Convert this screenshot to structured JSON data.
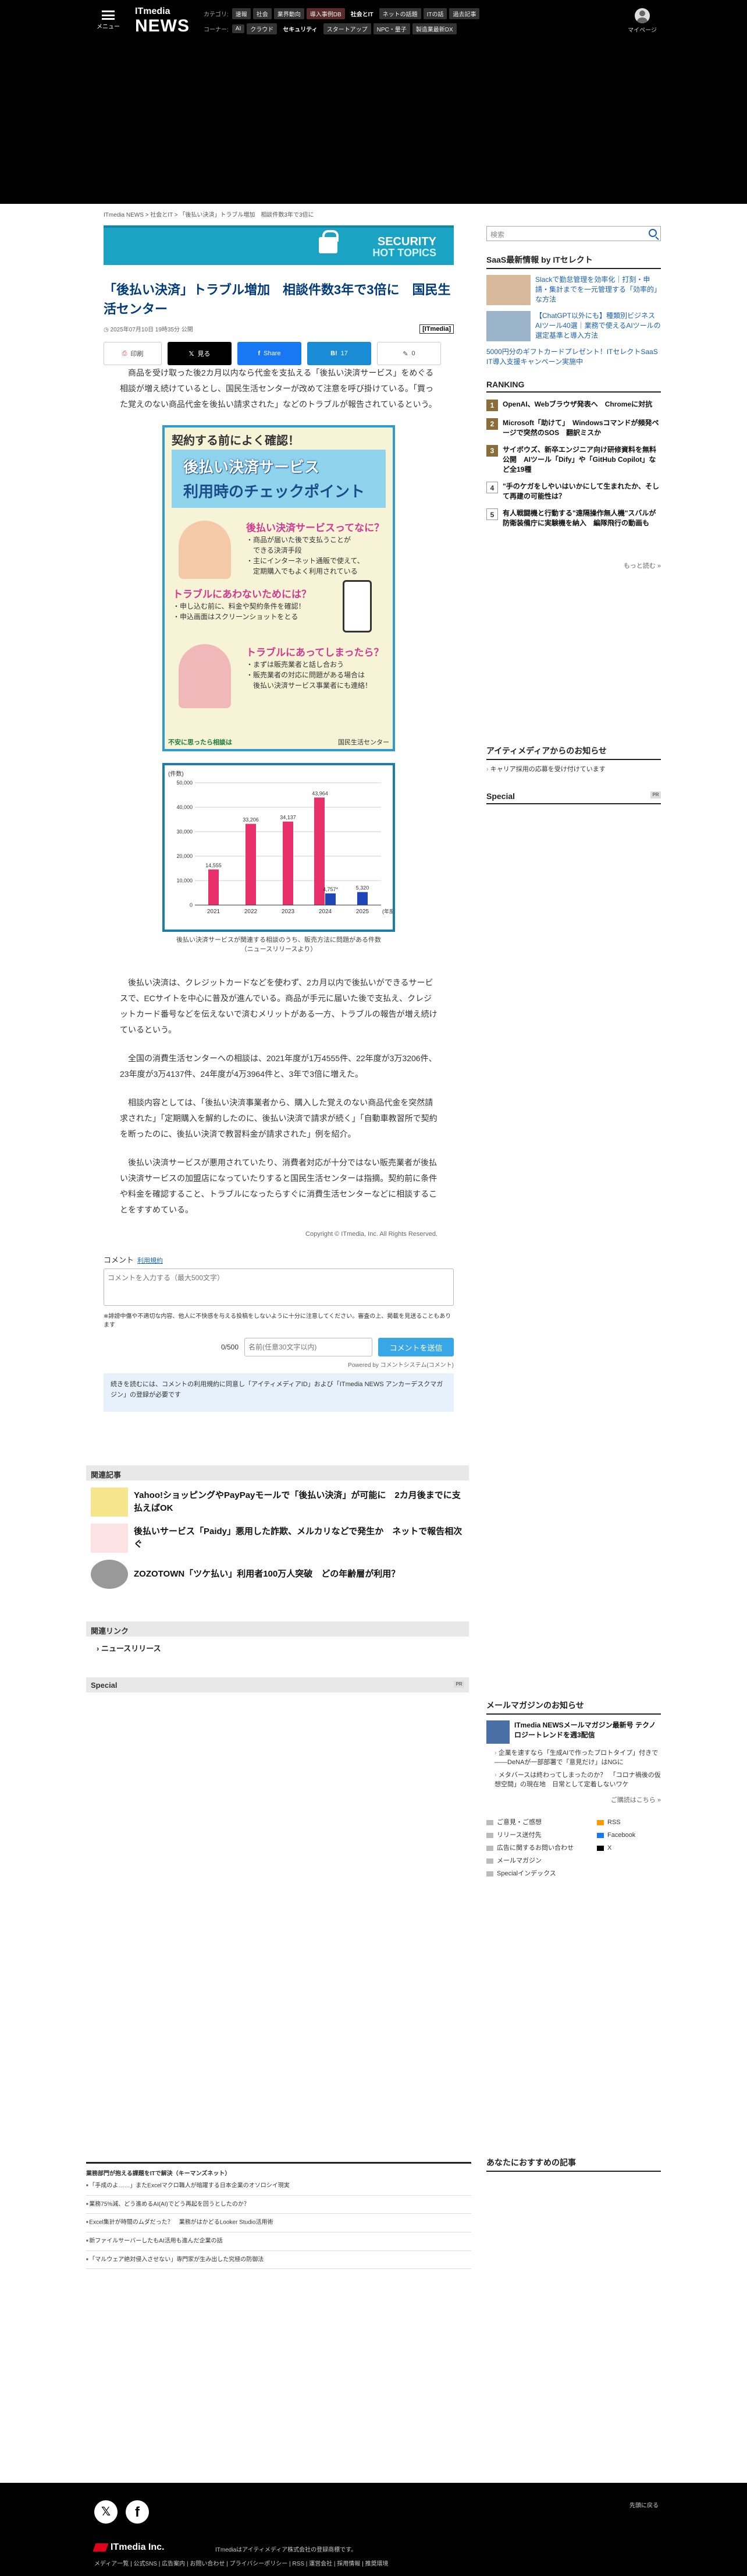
{
  "header": {
    "menu_label": "メニュー",
    "logo_it": "ITmedia",
    "logo_news": "NEWS",
    "categories_label": "カテゴリ:",
    "categories": [
      "速報",
      "社会",
      "業界動向",
      "導入事例DB",
      "社会とIT",
      "ネットの話題",
      "ITの話",
      "過去記事"
    ],
    "corners_label": "コーナー:",
    "corners": [
      "AI",
      "クラウド",
      "セキュリティ",
      "スタートアップ",
      "NPC・量子",
      "製造業最新DX"
    ],
    "mypage": "マイページ"
  },
  "breadcrumb": "ITmedia NEWS > 社会とIT > 「後払い決済」トラブル増加　相談件数3年で3倍に",
  "banner": {
    "line1": "SECURITY",
    "line2": "HOT TOPICS"
  },
  "article": {
    "title": "「後払い決済」トラブル増加　相談件数3年で3倍に　国民生活センター",
    "date": "2025年07月10日 19時35分 公開",
    "source": "[ITmedia]",
    "share": {
      "print": "印刷",
      "x": "見る",
      "facebook": "Share",
      "hatena_count": "17",
      "other_count": "0"
    },
    "paragraphs": [
      "商品を受け取った後2カ月以内なら代金を支払える「後払い決済サービス」をめぐる相談が増え続けているとし、国民生活センターが改めて注意を呼び掛けている。「買った覚えのない商品代金を後払い請求された」などのトラブルが報告されているという。",
      "後払い決済は、クレジットカードなどを使わず、2カ月以内で後払いができるサービスで、ECサイトを中心に普及が進んでいる。商品が手元に届いた後で支払え、クレジットカード番号などを伝えないで済むメリットがある一方、トラブルの報告が増え続けているという。",
      "全国の消費生活センターへの相談は、2021年度が1万4555件、22年度が3万3206件、23年度が3万4137件、24年度が4万3964件と、3年で3倍に増えた。",
      "相談内容としては、「後払い決済事業者から、購入した覚えのない商品代金を突然請求された」「定期購入を解約したのに、後払い決済で請求が続く」「自動車教習所で契約を断ったのに、後払い決済で教習料金が請求された」例を紹介。",
      "後払い決済サービスが悪用されていたり、消費者対応が十分ではない販売業者が後払い決済サービスの加盟店になっていたりすると国民生活センターは指摘。契約前に条件や料金を確認すること、トラブルになったらすぐに消費生活センターなどに相談することをすすめている。"
    ],
    "figure1": {
      "header": "契約する前によく確認！",
      "title1": "後払い決済サービス",
      "title2": "利用時のチェックポイント",
      "q1": "後払い決済サービスってなに？",
      "a1": [
        "・商品が届いた後で支払うことが",
        "　できる決済手段",
        "・主にインターネット通販で使えて、",
        "　定期購入でもよく利用されている"
      ],
      "q2": "トラブルにあわないためには？",
      "a2": [
        "・申し込む前に、料金や契約条件を確認！",
        "・申込画面はスクリーンショットをとる"
      ],
      "q3": "トラブルにあってしまったら？",
      "a3": [
        "・まずは販売業者と話し合おう",
        "・販売業者の対応に問題がある場合は",
        "　後払い決済サービス事業者にも連絡！"
      ],
      "footer_left": "不安に思ったら相談は",
      "footer_right": "国民生活センター"
    },
    "caption": [
      "後払い決済サービスが関連する相談のうち、販売方法に問題がある件数",
      "（ニュースリリースより）"
    ],
    "copyright": "Copyright © ITmedia, Inc. All Rights Reserved."
  },
  "chart_data": {
    "type": "bar",
    "categories": [
      "2021",
      "2022",
      "2023",
      "2024",
      "2025"
    ],
    "series": [
      {
        "values": [
          14555,
          33206,
          34137,
          43964,
          4757
        ],
        "color": "#e8306a"
      },
      {
        "values": [
          null,
          null,
          null,
          4757,
          5320
        ],
        "color": "#1f45b8"
      }
    ],
    "data_labels": [
      "14,555",
      "33,206",
      "34,137",
      "43,964",
      "4,757*",
      "5,320"
    ],
    "ylabel": "(件数)",
    "xlabel": "(年度)",
    "ylim": [
      0,
      50000
    ],
    "yticks": [
      "50,000",
      "40,000",
      "30,000",
      "20,000",
      "10,000",
      "0"
    ]
  },
  "comment": {
    "label": "コメント",
    "rules_link": "利用規約",
    "placeholder": "コメントを入力する（最大500文字）",
    "note": "※誹謗中傷や不適切な内容、他人に不快感を与える投稿をしないように十分に注意してください。審査の上、掲載を見送ることもあります",
    "count": "0/500",
    "name_placeholder": "名前(任意30文字以内)",
    "send": "コメントを送信",
    "powered": "Powered by コメントシステム(コメント)",
    "agree_pre": "続きを読むには、コメントの利用規約に同意し「アイティメディアID」および「ITmedia NEWS アンカーデスクマガジン」の登録が必要です"
  },
  "related": {
    "heading": "関連記事",
    "items": [
      "Yahoo!ショッピングやPayPayモールで「後払い決済」が可能に　2カ月後までに支払えばOK",
      "後払いサービス「Paidy」悪用した詐欺、メルカリなどで発生か　ネットで報告相次ぐ",
      "ZOZOTOWN「ツケ払い」利用者100万人突破　どの年齢層が利用？"
    ]
  },
  "links": {
    "heading": "関連リンク",
    "items": [
      "ニュースリリース"
    ]
  },
  "special_heading": "Special",
  "sidebar": {
    "search_placeholder": "検索",
    "saas_heading": "SaaS最新情報 by ITセレクト",
    "saas_items": [
      "Slackで勤怠管理を効率化｜打刻・申請・集計までを一元管理する「効率的」な方法",
      "【ChatGPT以外にも】種類別ビジネスAIツール40選｜業務で使えるAIツールの選定基準と導入方法"
    ],
    "saas_promo": "5000円分のギフトカードプレゼント！ITセレクトSaaS IT導入支援キャンペーン実施中",
    "ranking_heading": "RANKING",
    "ranking": [
      "OpenAI、Webブラウザ発表へ　Chromeに対抗",
      "Microsoft「助けて」　Windowsコマンドが頻発ページで突然のSOS　翻訳ミスか",
      "サイボウズ、新卒エンジニア向け研修資料を無料公開　AIツール「Dify」や「GitHub Copilot」など全19種",
      "\"手のケガをしやいはいかにして生まれたか、そして再建の可能性は？",
      "有人戦闘機と行動する\"遠隔操作無人機\"スバルが防衛装備庁に実験機を納入　編隊飛行の動画も"
    ],
    "ranking_more": "もっと読む »",
    "media_heading": "アイティメディアからのお知らせ",
    "media_items": [
      "キャリア採用の応募を受け付けています"
    ],
    "special_heading": "Special",
    "mm_heading": "メールマガジンのお知らせ",
    "mm_title": "ITmedia NEWSメールマガジン最新号 テクノロジートレンドを週3配信",
    "mm_items": [
      "企業を速すなら「生成AIで作ったプロトタイプ」付きで――DeNAが一部部署で「意見だけ」はNGに",
      "メタバースは終わってしまったのか？　「コロナ禍後の仮想空間」の現在地　日常として定着しないワケ"
    ],
    "mm_more": "ご購読はこちら »",
    "footer_links": [
      "ご意見・ご感想",
      "RSS",
      "リリース送付先",
      "Facebook",
      "広告に関するお問い合わせ",
      "X",
      "メールマガジン",
      "Specialインデックス"
    ],
    "recommend_heading": "あなたにおすすめの記事"
  },
  "bottom_section": {
    "heading": "業務部門が抱える課題をITで解決（キーマンズネット）",
    "items": [
      "「手成のよ……」またExcelマクロ職人が暗躍する日本企業のオソロシイ現実",
      "業務75%減、どう進めるAI(AI)でどう再起を回うとしたのか？",
      "Excel集計が時間のムダだった？　業務がはかどるLooker Studio活用術",
      "新ファイルサーバーしたもAI活用も進んだ企業の話",
      "「マルウェア絶対侵入させない」専門家が生み出した究極の防御法"
    ]
  },
  "footer": {
    "brand": "ITmedia Inc.",
    "notice": "ITmediaはアイティメディア株式会社の登録商標です。",
    "links": "メディア一覧 | 公式SNS | 広告案内 | お問い合わせ | プライバシーポリシー | RSS | 運営会社 | 採用情報 | 推奨環境",
    "pagetop": "先頭に戻る"
  }
}
